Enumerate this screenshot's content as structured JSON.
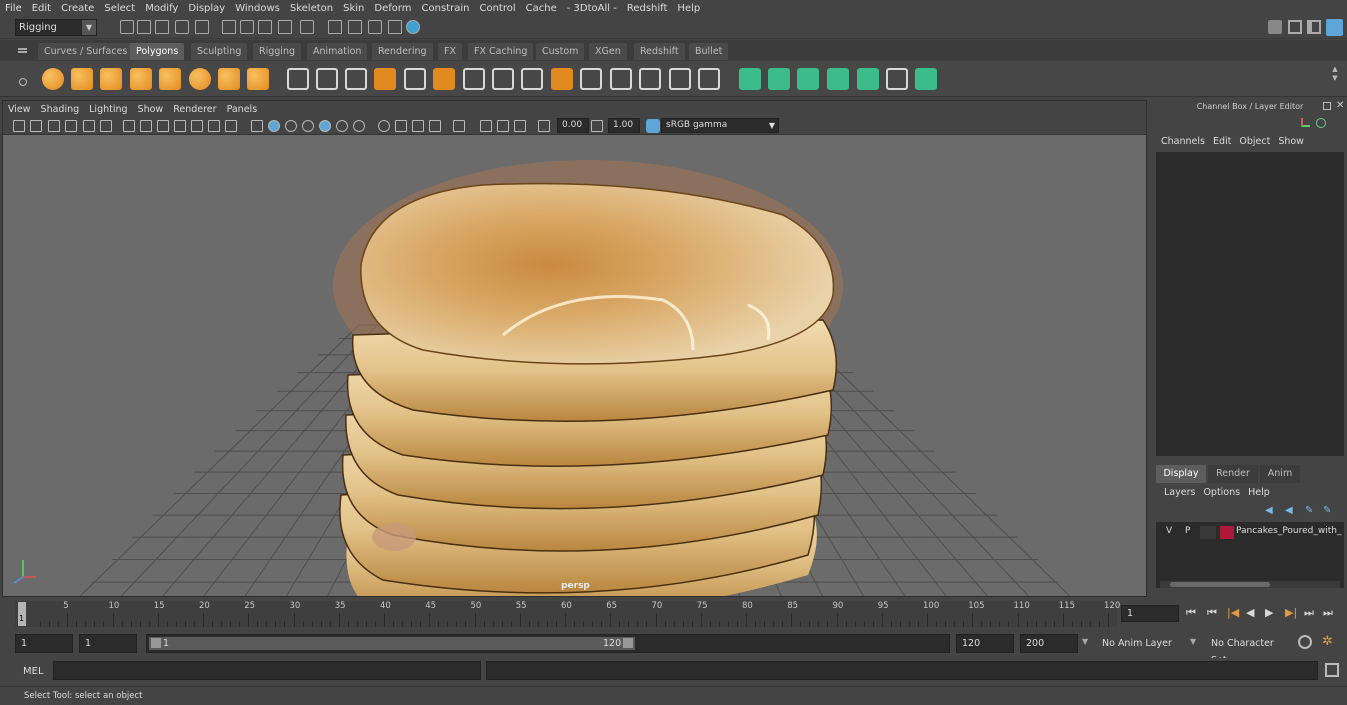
{
  "menubar": [
    "File",
    "Edit",
    "Create",
    "Select",
    "Modify",
    "Display",
    "Windows",
    "Skeleton",
    "Skin",
    "Deform",
    "Constrain",
    "Control",
    "Cache",
    "- 3DtoAll -",
    "Redshift",
    "Help"
  ],
  "menuset": {
    "value": "Rigging"
  },
  "shelf_tabs": [
    "Curves / Surfaces",
    "Polygons",
    "Sculpting",
    "Rigging",
    "Animation",
    "Rendering",
    "FX",
    "FX Caching",
    "Custom",
    "XGen",
    "Redshift",
    "Bullet"
  ],
  "shelf_active": "Polygons",
  "shelf_icons": [
    "sphere-icon",
    "cube-icon",
    "cylinder-icon",
    "cone-icon",
    "plane-icon",
    "torus-icon",
    "pyramid-icon",
    "pipe-icon",
    "combine-icon",
    "separate-icon",
    "mirror-icon",
    "smooth-icon",
    "extract-icon",
    "booleans-icon",
    "bevel-icon",
    "bridge-icon",
    "extrude-icon",
    "merge-icon",
    "fill-hole-icon",
    "target-weld-icon",
    "crease-icon",
    "multi-cut-icon",
    "quad-draw-icon",
    "uv-editor-icon",
    "planar-uv-icon",
    "auto-uv-icon",
    "cut-uv-icon",
    "sew-uv-icon",
    "unfold-uv-icon",
    "layout-uv-icon",
    "uv-options-icon"
  ],
  "viewport": {
    "menu": [
      "View",
      "Shading",
      "Lighting",
      "Show",
      "Renderer",
      "Panels"
    ],
    "exposure": "0.00",
    "gamma": "1.00",
    "colorspace": "sRGB gamma",
    "camera": "persp"
  },
  "channel_box": {
    "title": "Channel Box / Layer Editor",
    "menu": [
      "Channels",
      "Edit",
      "Object",
      "Show"
    ]
  },
  "layer_editor": {
    "tabs": [
      "Display",
      "Render",
      "Anim"
    ],
    "active_tab": "Display",
    "menu": [
      "Layers",
      "Options",
      "Help"
    ],
    "layers": [
      {
        "v": "V",
        "p": "P",
        "color": "#b0183a",
        "name": "Pancakes_Poured_with_S"
      }
    ]
  },
  "timeline": {
    "ticks": [
      "5",
      "10",
      "15",
      "20",
      "25",
      "30",
      "35",
      "40",
      "45",
      "50",
      "55",
      "60",
      "65",
      "70",
      "75",
      "80",
      "85",
      "90",
      "95",
      "100",
      "105",
      "110",
      "115",
      "120"
    ],
    "current_marker": "1",
    "current_frame": "1"
  },
  "range": {
    "start": "1",
    "playback_start": "1",
    "slider_start": "1",
    "slider_end": "120",
    "playback_end": "120",
    "end": "200",
    "anim_layer": "No Anim Layer",
    "char_set": "No Character Set"
  },
  "mel": {
    "label": "MEL"
  },
  "help": {
    "text": "Select Tool: select an object"
  }
}
